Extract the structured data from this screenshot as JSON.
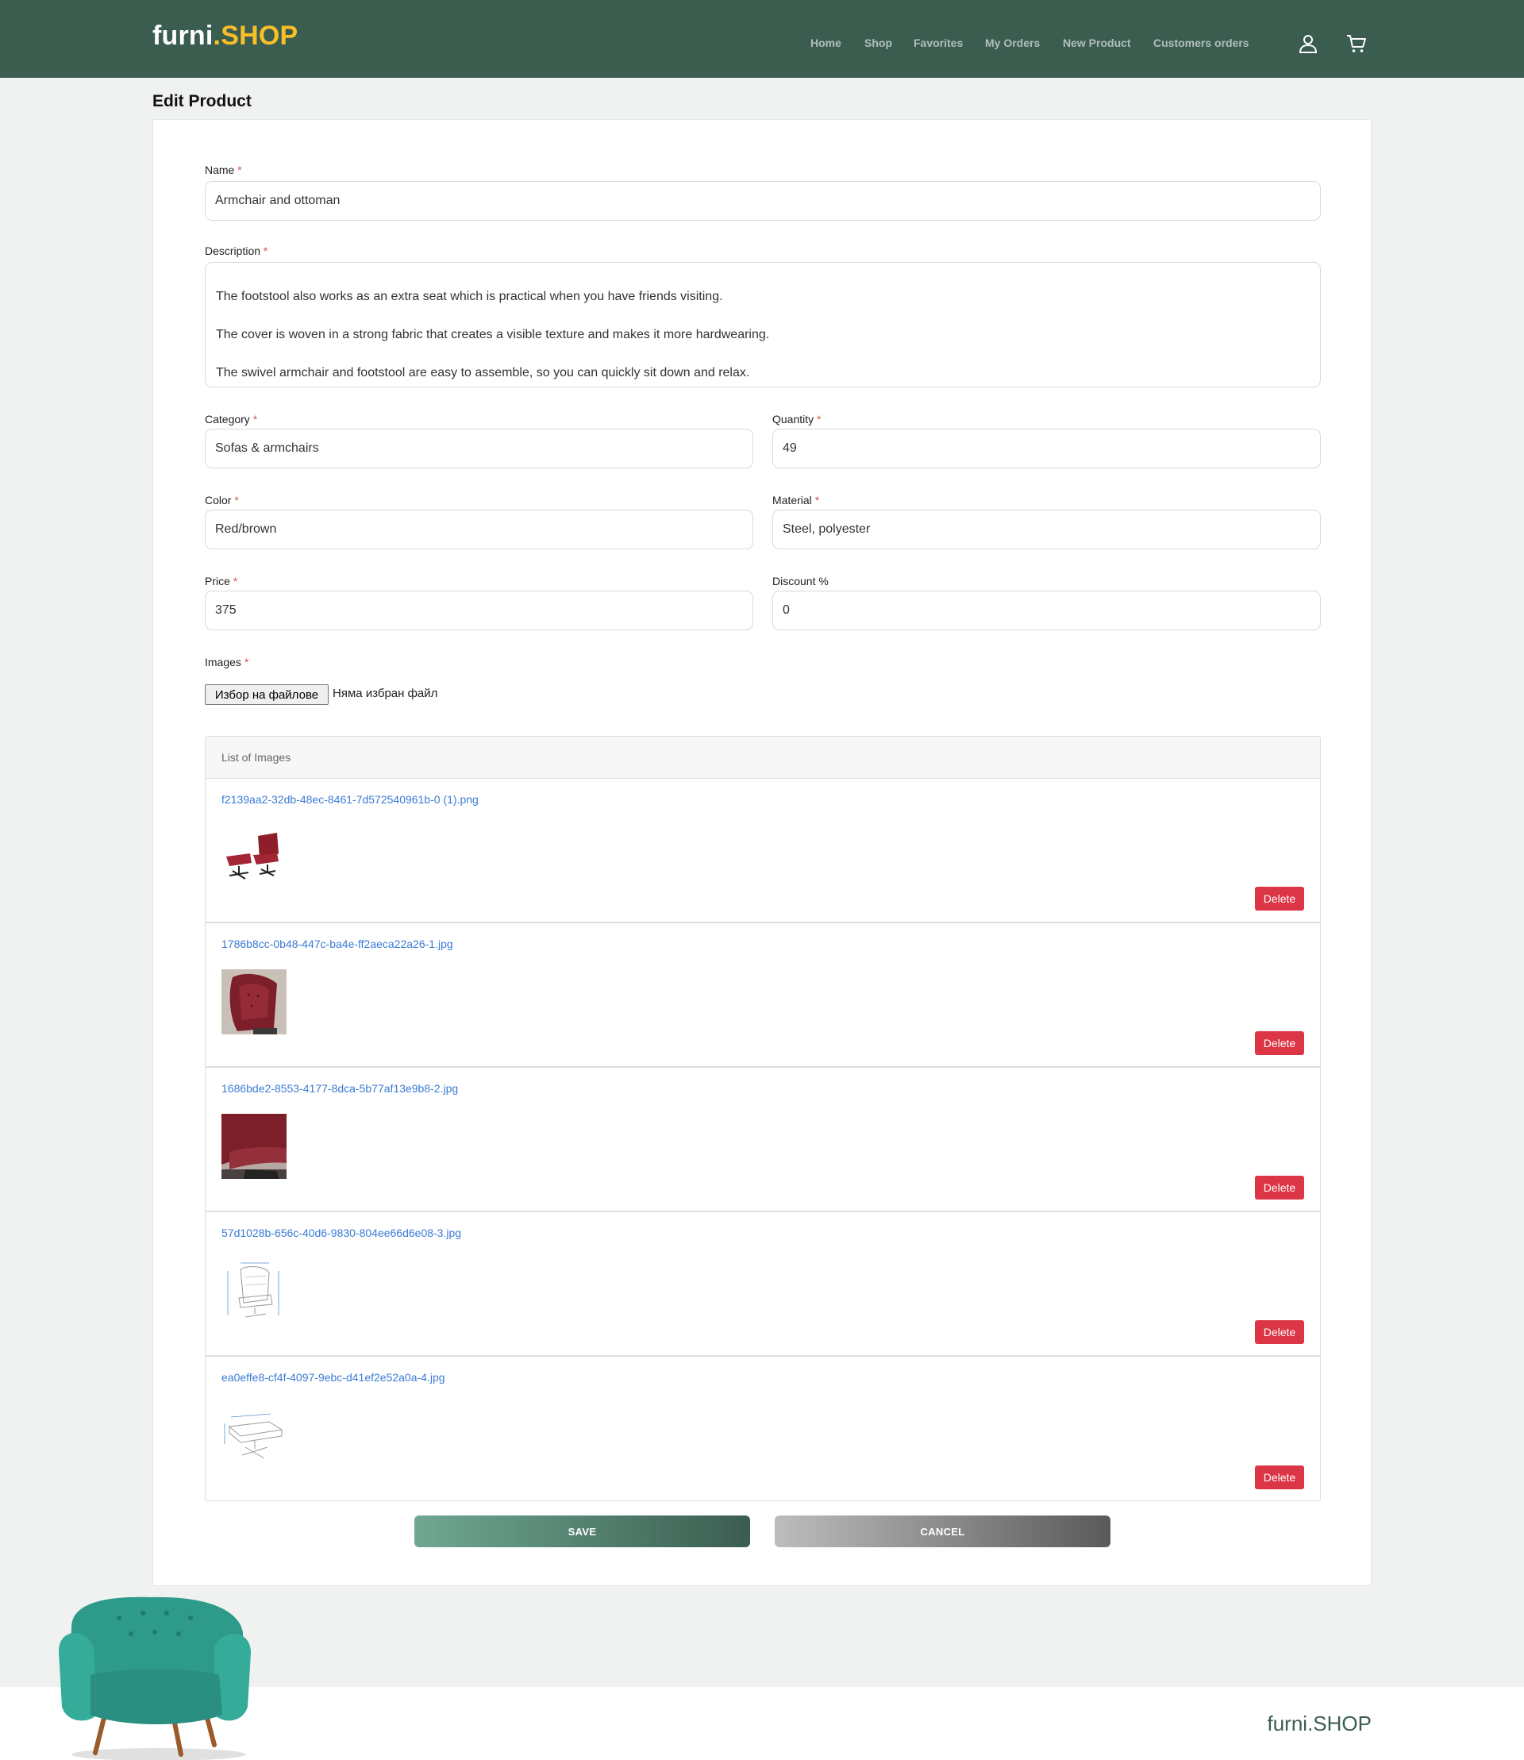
{
  "brand": {
    "name": "furni",
    "dot": ".",
    "suffix": "SHOP"
  },
  "nav": {
    "items": [
      "Home",
      "Shop",
      "Favorites",
      "My Orders",
      "New Product",
      "Customers orders"
    ],
    "icons": [
      "user-icon",
      "cart-icon"
    ]
  },
  "page": {
    "title": "Edit Product"
  },
  "form": {
    "required_mark": "*",
    "name": {
      "label": "Name",
      "value": "Armchair and ottoman"
    },
    "description": {
      "label": "Description",
      "lines": [
        "The footstool also works as an extra seat which is practical when you have friends visiting.",
        "The cover is woven in a strong fabric that creates a visible texture and makes it more hardwearing.",
        "The swivel armchair and footstool are easy to assemble, so you can quickly sit down and relax."
      ]
    },
    "category": {
      "label": "Category",
      "value": "Sofas & armchairs"
    },
    "quantity": {
      "label": "Quantity",
      "value": "49"
    },
    "color": {
      "label": "Color",
      "value": "Red/brown"
    },
    "material": {
      "label": "Material",
      "value": "Steel, polyester"
    },
    "price": {
      "label": "Price",
      "value": "375"
    },
    "discount": {
      "label": "Discount %",
      "value": "0"
    },
    "images": {
      "label": "Images",
      "file_button": "Избор на файлове",
      "file_status": "Няма избран файл"
    }
  },
  "image_list": {
    "header": "List of Images",
    "delete_label": "Delete",
    "items": [
      {
        "name": "f2139aa2-32db-48ec-8461-7d572540961b-0 (1).png"
      },
      {
        "name": "1786b8cc-0b48-447c-ba4e-ff2aeca22a26-1.jpg"
      },
      {
        "name": "1686bde2-8553-4177-8dca-5b77af13e9b8-2.jpg"
      },
      {
        "name": "57d1028b-656c-40d6-9830-804ee66d6e08-3.jpg"
      },
      {
        "name": "ea0effe8-cf4f-4097-9ebc-d41ef2e52a0a-4.jpg"
      }
    ]
  },
  "actions": {
    "save": "SAVE",
    "cancel": "CANCEL"
  },
  "footer": {
    "brand": "furni.SHOP"
  },
  "colors": {
    "nav_bg": "#3b5d50",
    "accent_yellow": "#f9bf29",
    "delete_red": "#dc3545",
    "link_blue": "#3a7bd5",
    "chair_teal": "#2f9e8f"
  }
}
